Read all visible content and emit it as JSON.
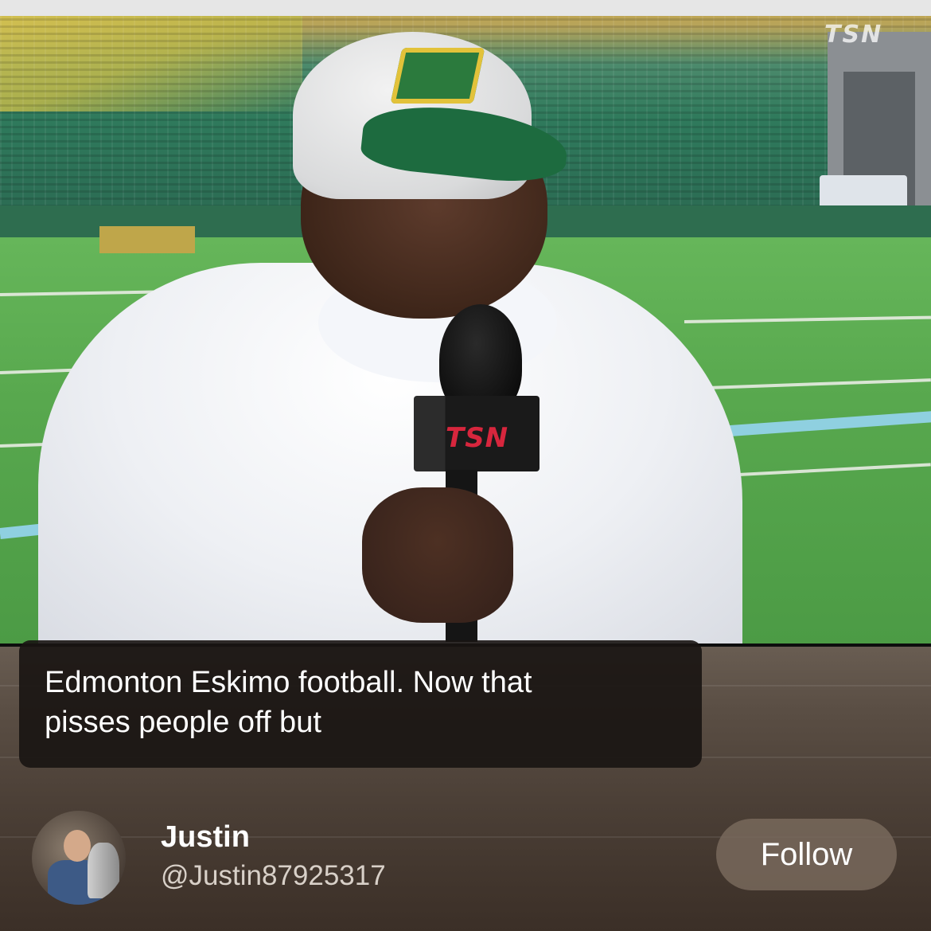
{
  "video": {
    "broadcaster_bug": "TSN",
    "mic_flag_label": "TSN"
  },
  "caption": {
    "lines": [
      "Edmonton Eskimo football. Now that",
      "pisses people off but"
    ]
  },
  "author": {
    "name": "Justin",
    "handle": "@Justin87925317",
    "follow_label": "Follow"
  },
  "colors": {
    "caption_background": "#181412",
    "follow_button": "#78695c",
    "field_green": "#58a84e",
    "stands_green": "#2f7a5c"
  }
}
